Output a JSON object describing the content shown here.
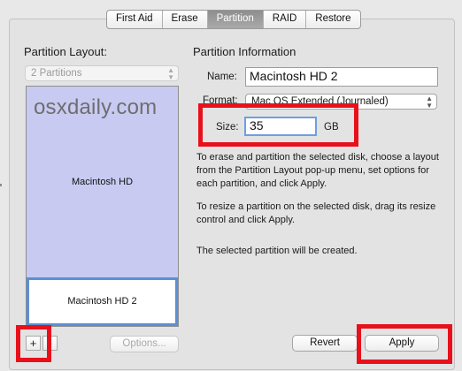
{
  "tabs": [
    {
      "label": "First Aid",
      "active": false
    },
    {
      "label": "Erase",
      "active": false
    },
    {
      "label": "Partition",
      "active": true
    },
    {
      "label": "RAID",
      "active": false
    },
    {
      "label": "Restore",
      "active": false
    }
  ],
  "partition_layout": {
    "title": "Partition Layout:",
    "select_value": "2 Partitions",
    "partitions": [
      {
        "label": "Macintosh HD",
        "selected": false
      },
      {
        "label": "Macintosh HD 2",
        "selected": true
      }
    ]
  },
  "watermark": "osxdaily.com",
  "bottom_left": {
    "add_label": "+",
    "remove_label": "-",
    "options_label": "Options..."
  },
  "partition_info": {
    "title": "Partition Information",
    "name_label": "Name:",
    "name_value": "Macintosh HD 2",
    "format_label": "Format:",
    "format_value": "Mac OS Extended (Journaled)",
    "size_label": "Size:",
    "size_value": "35",
    "size_unit": "GB",
    "instructions": [
      "To erase and partition the selected disk, choose a layout from the Partition Layout pop-up menu, set options for each partition, and click Apply.",
      "To resize a partition on the selected disk, drag its resize control and click Apply.",
      "The selected partition will be created."
    ]
  },
  "buttons": {
    "revert_label": "Revert",
    "apply_label": "Apply"
  },
  "colors": {
    "annotation_red": "#e8111b",
    "selection_blue": "#5b8fd6",
    "partition_fill": "#c8caf2"
  }
}
